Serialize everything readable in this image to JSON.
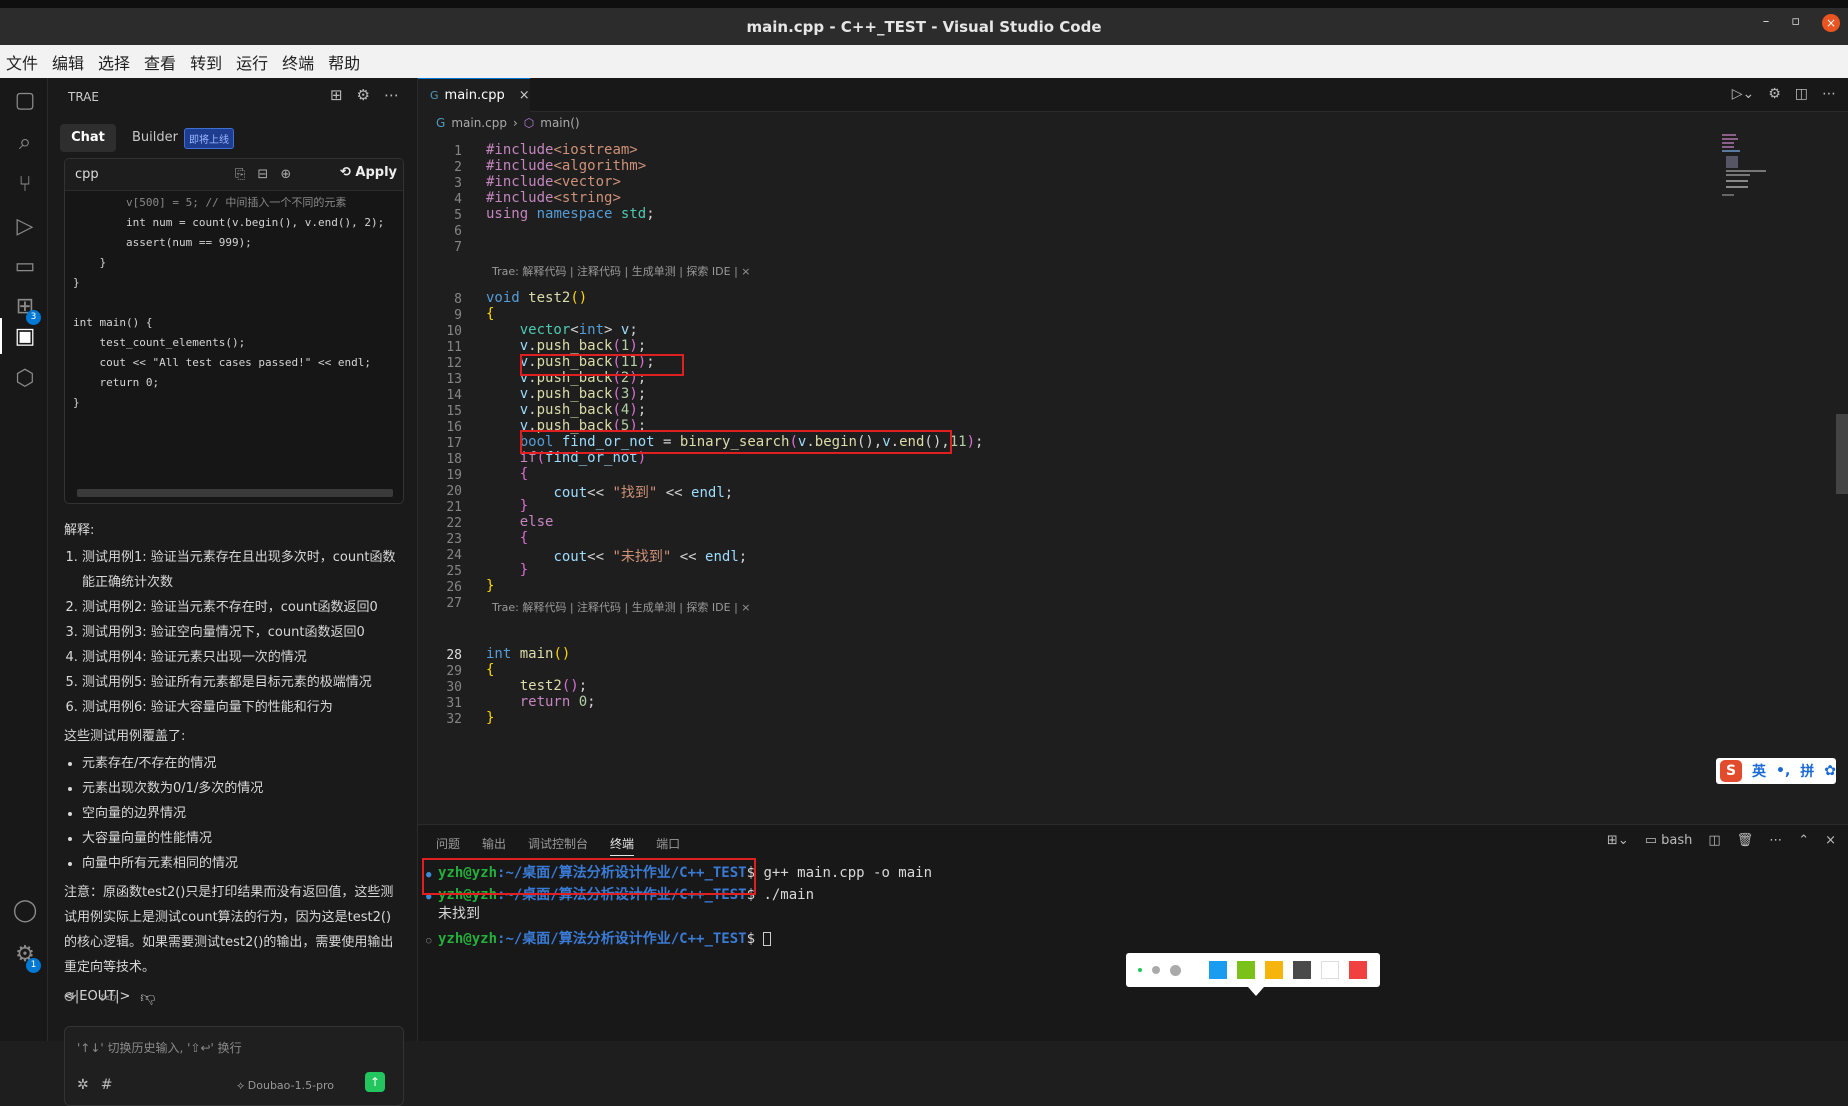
{
  "window": {
    "title": "main.cpp - C++_TEST - Visual Studio Code",
    "min": "–",
    "max": "▫",
    "close": "×"
  },
  "menu": [
    "文件",
    "编辑",
    "选择",
    "查看",
    "转到",
    "运行",
    "终端",
    "帮助"
  ],
  "activity": {
    "explorer": "▢",
    "search": "⌕",
    "scm": "⑂",
    "debug": "▷",
    "remote": "▭",
    "extensions": "⊞",
    "extensions_badge": "3",
    "trae": "▣",
    "box": "⬡",
    "account": "◯",
    "settings": "⚙",
    "settings_badge": "1"
  },
  "sidebar": {
    "header": "TRAE",
    "tools": [
      "⊞",
      "⚙",
      "⋯"
    ],
    "tab_chat": "Chat",
    "tab_builder": "Builder",
    "builder_badge": "即将上线",
    "code_card": {
      "lang": "cpp",
      "apply": "Apply",
      "lines": [
        "        v[500] = 5; // 中间插入一个不同的元素",
        "        int num = count(v.begin(), v.end(), 2);",
        "        assert(num == 999);",
        "    }",
        "}",
        "",
        "int main() {",
        "    test_count_elements();",
        "    cout << \"All test cases passed!\" << endl;",
        "    return 0;",
        "}"
      ]
    },
    "explain_title": "解释:",
    "explain_items": [
      "测试用例1: 验证当元素存在且出现多次时，count函数能正确统计次数",
      "测试用例2: 验证当元素不存在时，count函数返回0",
      "测试用例3: 验证空向量情况下，count函数返回0",
      "测试用例4: 验证元素只出现一次的情况",
      "测试用例5: 验证所有元素都是目标元素的极端情况",
      "测试用例6: 验证大容量向量下的性能和行为"
    ],
    "cover_title": "这些测试用例覆盖了:",
    "cover_items": [
      "元素存在/不存在的情况",
      "元素出现次数为0/1/多次的情况",
      "空向量的边界情况",
      "大容量向量的性能情况",
      "向量中所有元素相同的情况"
    ],
    "note": "注意：原函数test2()只是打印结果而没有返回值，这些测试用例实际上是测试count算法的行为，因为这是test2()的核心逻辑。如果需要测试test2()的输出，需要使用输出重定向等技术。",
    "eout": "<|EOUT|>",
    "input_placeholder": "'↑↓' 切换历史输入, '⇧↩' 换行",
    "model": "Doubao-1.5-pro",
    "send": "↑"
  },
  "editor": {
    "tab": "main.cpp",
    "breadcrumb_file": "main.cpp",
    "breadcrumb_symbol": "main()",
    "codelens": "Trae: 解释代码 | 注释代码 | 生成单测 | 探索 IDE | ×",
    "line_numbers": [
      "1",
      "2",
      "3",
      "4",
      "5",
      "6",
      "7",
      "8",
      "9",
      "10",
      "11",
      "12",
      "13",
      "14",
      "15",
      "16",
      "17",
      "18",
      "19",
      "20",
      "21",
      "22",
      "23",
      "24",
      "25",
      "26",
      "27",
      "28",
      "29",
      "30",
      "31",
      "32"
    ]
  },
  "ime": {
    "logo": "S",
    "lang": "英",
    "punct": "•,",
    "mode": "拼",
    "gear": "✿"
  },
  "panel": {
    "tabs": [
      "问题",
      "输出",
      "调试控制台",
      "终端",
      "端口"
    ],
    "active_tab": "终端",
    "shell": "bash",
    "terminal": [
      {
        "user": "yzh@yzh",
        "path": ":~/桌面/算法分析设计作业/C++_TEST",
        "cmd": "$ g++ main.cpp -o main"
      },
      {
        "user": "yzh@yzh",
        "path": ":~/桌面/算法分析设计作业/C++_TEST",
        "cmd": "$ ./main"
      },
      {
        "output": "未找到"
      },
      {
        "user": "yzh@yzh",
        "path": ":~/桌面/算法分析设计作业/C++_TEST",
        "cmd": "$ "
      }
    ]
  },
  "palette": {
    "colors": [
      "#1a9cf0",
      "#7ac11a",
      "#f5b50d",
      "#4a4a4a",
      "#ffffff",
      "#f04040"
    ]
  }
}
